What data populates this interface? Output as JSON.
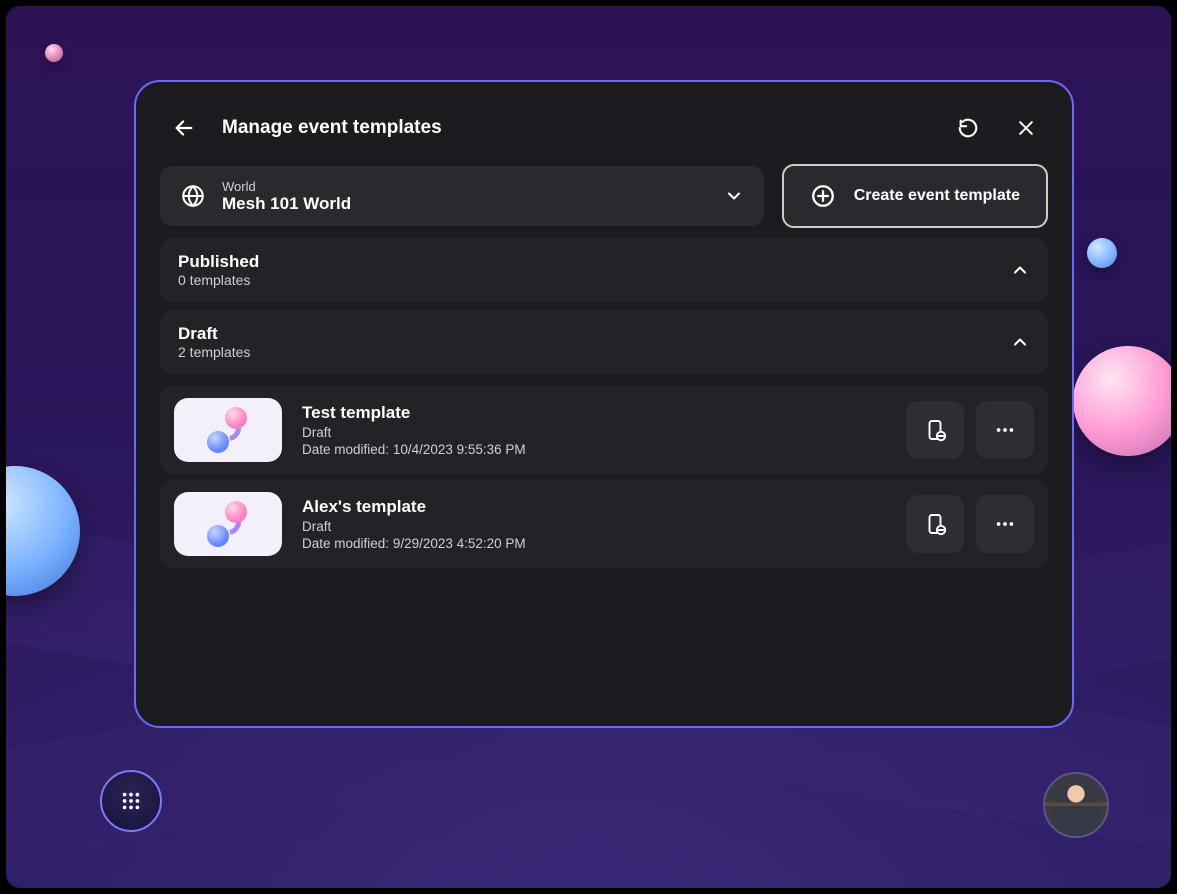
{
  "header": {
    "title": "Manage event templates"
  },
  "world_picker": {
    "label": "World",
    "value": "Mesh 101 World"
  },
  "create_button": {
    "label": "Create event template"
  },
  "sections": {
    "published": {
      "title": "Published",
      "subtitle": "0 templates"
    },
    "draft": {
      "title": "Draft",
      "subtitle": "2 templates"
    }
  },
  "templates": [
    {
      "name": "Test template",
      "status": "Draft",
      "modified_label": "Date modified:",
      "modified": "10/4/2023 9:55:36 PM"
    },
    {
      "name": "Alex's template",
      "status": "Draft",
      "modified_label": "Date modified:",
      "modified": "9/29/2023 4:52:20 PM"
    }
  ]
}
